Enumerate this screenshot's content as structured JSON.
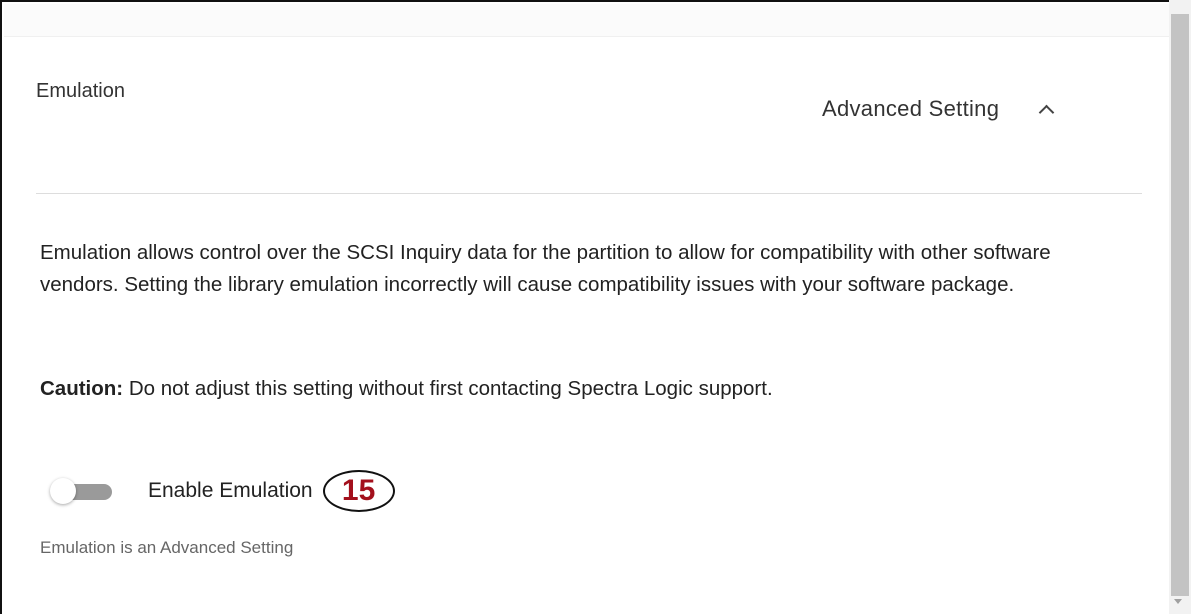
{
  "section": {
    "title": "Emulation",
    "advanced_label": "Advanced Setting",
    "advanced_expanded": true
  },
  "content": {
    "description": "Emulation allows control over the SCSI Inquiry data for the partition to allow for compatibility with other software vendors. Setting the library emulation incorrectly will cause compatibility issues with your software package.",
    "caution_label": "Caution:",
    "caution_text": " Do not adjust this setting without first contacting Spectra Logic support.",
    "switch_label": "Enable Emulation",
    "switch_on": false,
    "callout_number": "15",
    "helper_text": "Emulation is an Advanced Setting"
  },
  "colors": {
    "callout_number": "#a3101c",
    "switch_track_off": "#9a9a9a",
    "scroll_thumb": "#c3c3c3"
  },
  "icons": {
    "collapse": "chevron-up-icon",
    "scroll_down": "scroll-down-arrow-icon"
  }
}
